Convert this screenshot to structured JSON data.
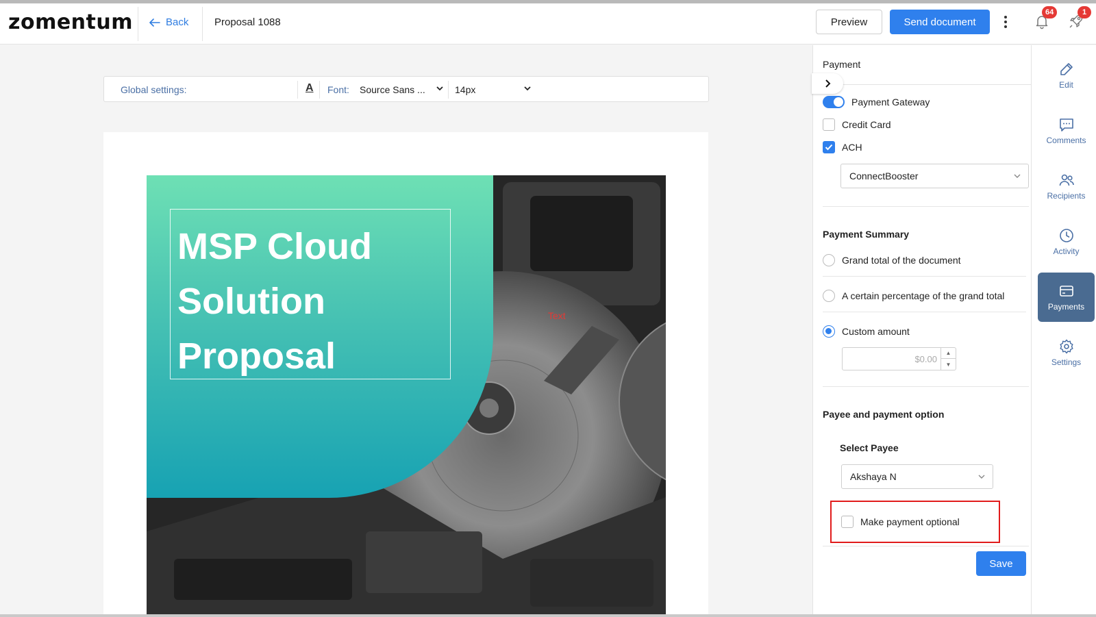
{
  "header": {
    "logo": "zomentum",
    "back_label": "Back",
    "doc_title": "Proposal 1088",
    "preview_label": "Preview",
    "send_label": "Send document",
    "notifications_count": "64",
    "updates_count": "1"
  },
  "global_settings": {
    "label": "Global settings:",
    "text_color_glyph": "A",
    "font_label": "Font:",
    "font_value": "Source Sans ...",
    "size_value": "14px"
  },
  "cover": {
    "title_lines": [
      "MSP Cloud",
      "Solution",
      "Proposal"
    ],
    "text_placeholder": "Text"
  },
  "payment_panel": {
    "heading": "Payment",
    "gateway": {
      "label": "Payment Gateway",
      "enabled": true
    },
    "methods": [
      {
        "label": "Credit Card",
        "checked": false
      },
      {
        "label": "ACH",
        "checked": true
      }
    ],
    "provider": "ConnectBooster",
    "summary": {
      "title": "Payment Summary",
      "options": [
        {
          "label": "Grand total of the document",
          "selected": false
        },
        {
          "label": "A certain percentage of the grand total",
          "selected": false
        },
        {
          "label": "Custom amount",
          "selected": true
        }
      ],
      "amount_value": "$0.00"
    },
    "payee": {
      "title": "Payee and payment option",
      "select_label": "Select Payee",
      "selected": "Akshaya N",
      "optional_label": "Make payment optional",
      "optional_checked": false
    },
    "save_label": "Save"
  },
  "rail": {
    "items": [
      {
        "label": "Edit",
        "icon": "pencil-icon",
        "active": false
      },
      {
        "label": "Comments",
        "icon": "comment-icon",
        "active": false
      },
      {
        "label": "Recipients",
        "icon": "users-icon",
        "active": false
      },
      {
        "label": "Activity",
        "icon": "clock-icon",
        "active": false
      },
      {
        "label": "Payments",
        "icon": "card-icon",
        "active": true
      },
      {
        "label": "Settings",
        "icon": "gear-icon",
        "active": false
      }
    ]
  },
  "colors": {
    "accent": "#2f80ed",
    "active_rail": "#4a6b91",
    "highlight": "#e11b1b",
    "teal_top": "#6ee0b4",
    "teal_bottom": "#17a2b3"
  }
}
